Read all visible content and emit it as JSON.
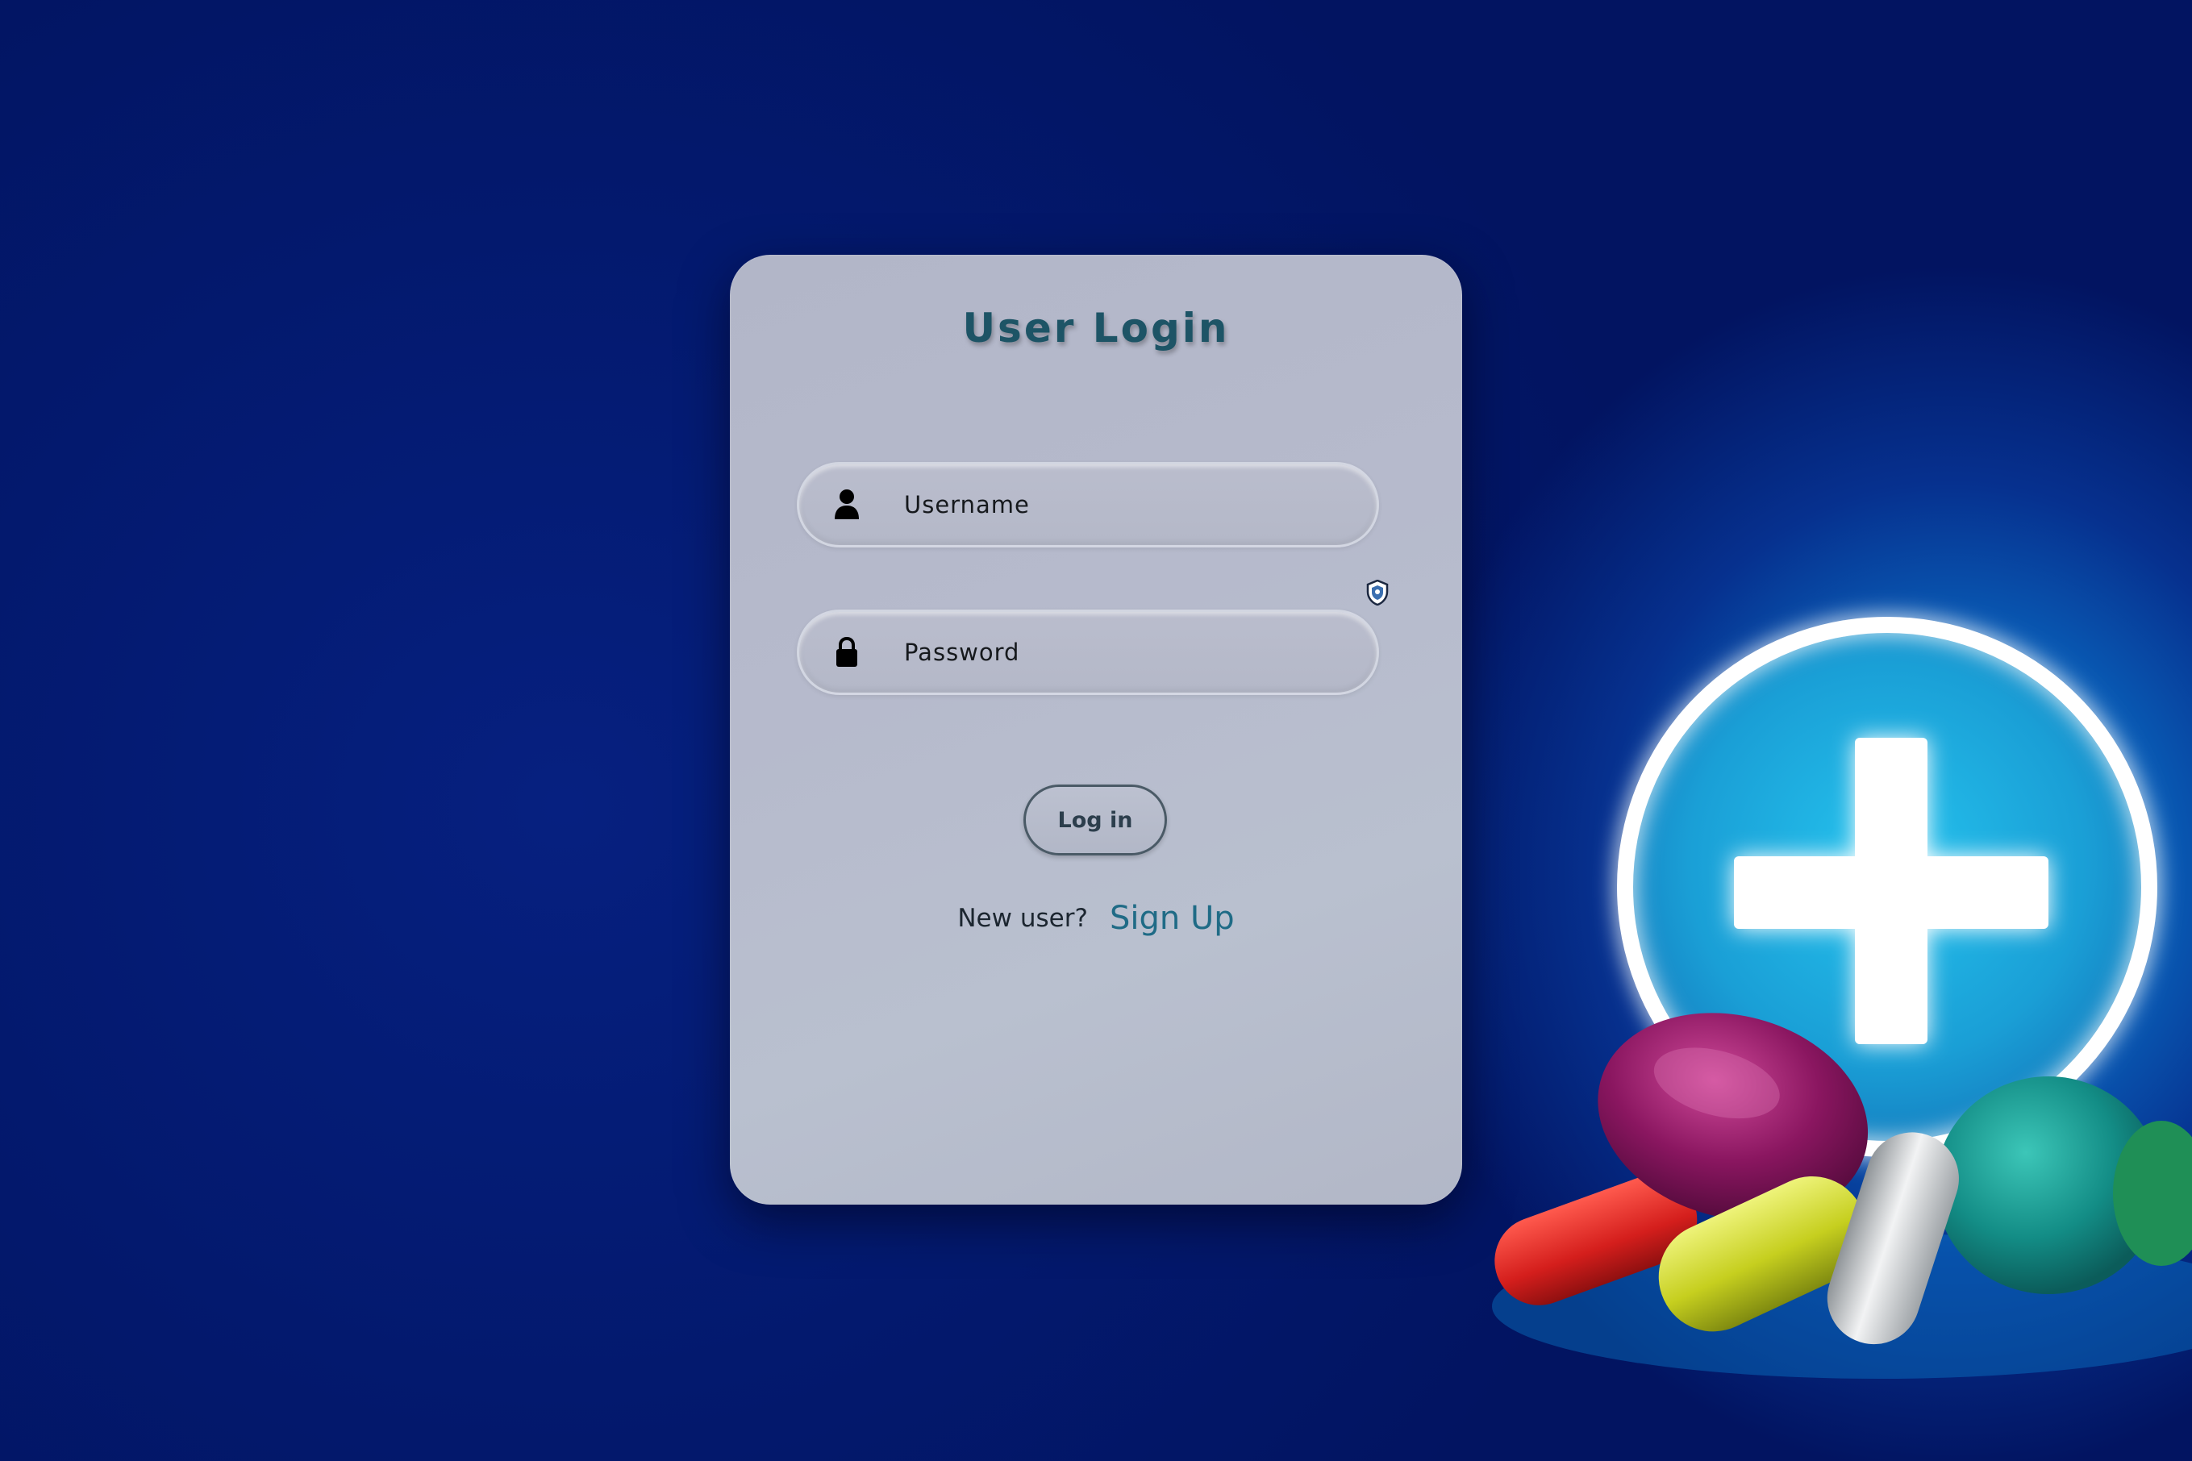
{
  "login": {
    "title": "User Login",
    "username_placeholder": "Username",
    "password_placeholder": "Password",
    "login_button": "Log in",
    "new_user_text": "New user?",
    "sign_up_link": "Sign Up"
  },
  "icons": {
    "username": "user-icon",
    "password": "lock-icon",
    "password_manager": "shield-icon",
    "background": "medical-cross-with-pills"
  },
  "colors": {
    "background": "#03186a",
    "title": "#1d5466",
    "sign_up": "#1f6b86",
    "card": "#b6bacc"
  }
}
